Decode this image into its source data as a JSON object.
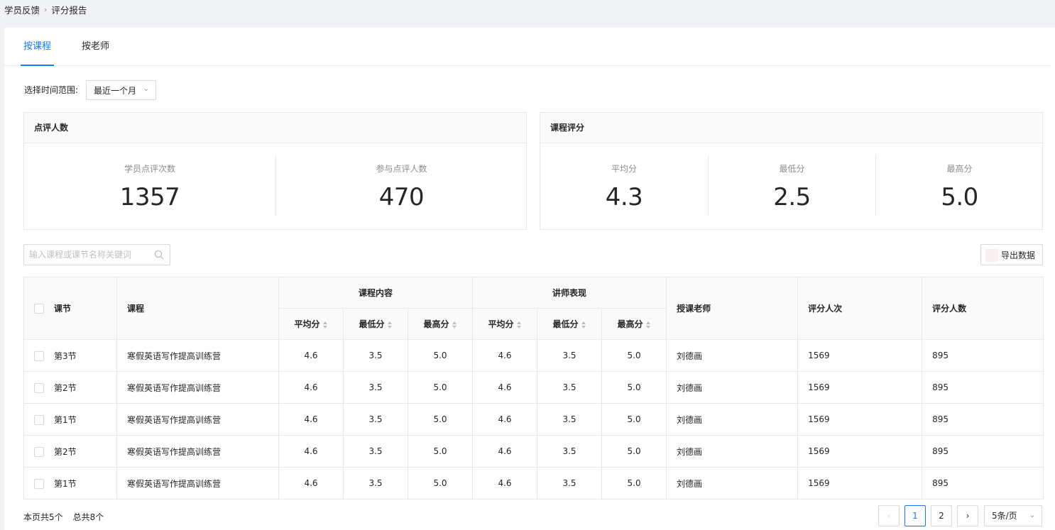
{
  "breadcrumb": {
    "parent": "学员反馈",
    "separator": "›",
    "current": "评分报告"
  },
  "tabs": [
    {
      "label": "按课程",
      "active": true
    },
    {
      "label": "按老师",
      "active": false
    }
  ],
  "time_range": {
    "label": "选择时间范围:",
    "value": "最近一个月"
  },
  "review_card": {
    "title": "点评人数",
    "stats": [
      {
        "label": "学员点评次数",
        "value": "1357"
      },
      {
        "label": "参与点评人数",
        "value": "470"
      }
    ]
  },
  "score_card": {
    "title": "课程评分",
    "stats": [
      {
        "label": "平均分",
        "value": "4.3"
      },
      {
        "label": "最低分",
        "value": "2.5"
      },
      {
        "label": "最高分",
        "value": "5.0"
      }
    ]
  },
  "search": {
    "placeholder": "输入课程或课节名称关键词"
  },
  "export_label": "导出数据",
  "table": {
    "headers": {
      "lesson": "课节",
      "course": "课程",
      "content_group": "课程内容",
      "teacher_group": "讲师表现",
      "teacher": "授课老师",
      "rating_times": "评分人次",
      "rating_people": "评分人数",
      "avg": "平均分",
      "min": "最低分",
      "max": "最高分"
    },
    "rows": [
      {
        "lesson": "第3节",
        "course": "寒假英语写作提高训练营",
        "c_avg": "4.6",
        "c_min": "3.5",
        "c_max": "5.0",
        "t_avg": "4.6",
        "t_min": "3.5",
        "t_max": "5.0",
        "teacher": "刘德画",
        "times": "1569",
        "people": "895"
      },
      {
        "lesson": "第2节",
        "course": "寒假英语写作提高训练营",
        "c_avg": "4.6",
        "c_min": "3.5",
        "c_max": "5.0",
        "t_avg": "4.6",
        "t_min": "3.5",
        "t_max": "5.0",
        "teacher": "刘德画",
        "times": "1569",
        "people": "895"
      },
      {
        "lesson": "第1节",
        "course": "寒假英语写作提高训练营",
        "c_avg": "4.6",
        "c_min": "3.5",
        "c_max": "5.0",
        "t_avg": "4.6",
        "t_min": "3.5",
        "t_max": "5.0",
        "teacher": "刘德画",
        "times": "1569",
        "people": "895"
      },
      {
        "lesson": "第2节",
        "course": "寒假英语写作提高训练营",
        "c_avg": "4.6",
        "c_min": "3.5",
        "c_max": "5.0",
        "t_avg": "4.6",
        "t_min": "3.5",
        "t_max": "5.0",
        "teacher": "刘德画",
        "times": "1569",
        "people": "895"
      },
      {
        "lesson": "第1节",
        "course": "寒假英语写作提高训练营",
        "c_avg": "4.6",
        "c_min": "3.5",
        "c_max": "5.0",
        "t_avg": "4.6",
        "t_min": "3.5",
        "t_max": "5.0",
        "teacher": "刘德画",
        "times": "1569",
        "people": "895"
      }
    ]
  },
  "footer": {
    "page_count": "本页共5个",
    "total_count": "总共8个",
    "prev_icon": "‹",
    "next_icon": "›",
    "pages": [
      "1",
      "2"
    ],
    "current_page": "1",
    "page_size": "5条/页"
  },
  "colors": {
    "accent": "#1677ff",
    "border": "#e8e8e8",
    "header_bg": "#fafafa",
    "page_bg": "#f0f2f5"
  }
}
